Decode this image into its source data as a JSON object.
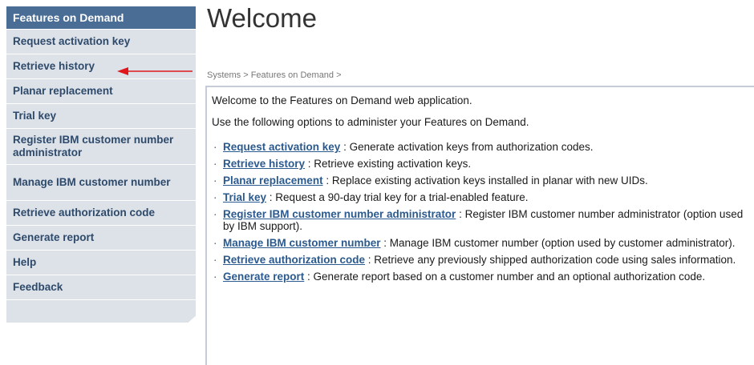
{
  "sidebar": {
    "header": "Features on Demand",
    "items": [
      {
        "label": "Request activation key"
      },
      {
        "label": "Retrieve history"
      },
      {
        "label": "Planar replacement"
      },
      {
        "label": "Trial key"
      },
      {
        "label": "Register IBM customer number administrator"
      },
      {
        "label": "Manage IBM customer number"
      },
      {
        "label": "Retrieve authorization code"
      },
      {
        "label": "Generate report"
      },
      {
        "label": "Help"
      },
      {
        "label": "Feedback"
      }
    ]
  },
  "main": {
    "title": "Welcome",
    "breadcrumb": "Systems  >  Features on Demand  >",
    "intro1": "Welcome to the Features on Demand web application.",
    "intro2": "Use the following options to administer your Features on Demand.",
    "options": [
      {
        "link": "Request activation key",
        "desc": " : Generate activation keys from authorization codes."
      },
      {
        "link": "Retrieve history",
        "desc": " : Retrieve existing activation keys."
      },
      {
        "link": "Planar replacement",
        "desc": " : Replace existing activation keys installed in planar with new UIDs."
      },
      {
        "link": "Trial key",
        "desc": " : Request a 90-day trial key for a trial-enabled feature."
      },
      {
        "link": "Register IBM customer number administrator",
        "desc": " : Register IBM customer number administrator (option used by IBM support)."
      },
      {
        "link": "Manage IBM customer number",
        "desc": " : Manage IBM customer number (option used by customer administrator)."
      },
      {
        "link": "Retrieve authorization code",
        "desc": " : Retrieve any previously shipped authorization code using sales information."
      },
      {
        "link": "Generate report",
        "desc": " : Generate report based on a customer number and an optional authorization code."
      }
    ]
  },
  "colors": {
    "sidebar_header_bg": "#4a6d96",
    "sidebar_item_bg": "#dde2e9",
    "link": "#2a5a8f",
    "annotation_arrow": "#e0161d"
  }
}
